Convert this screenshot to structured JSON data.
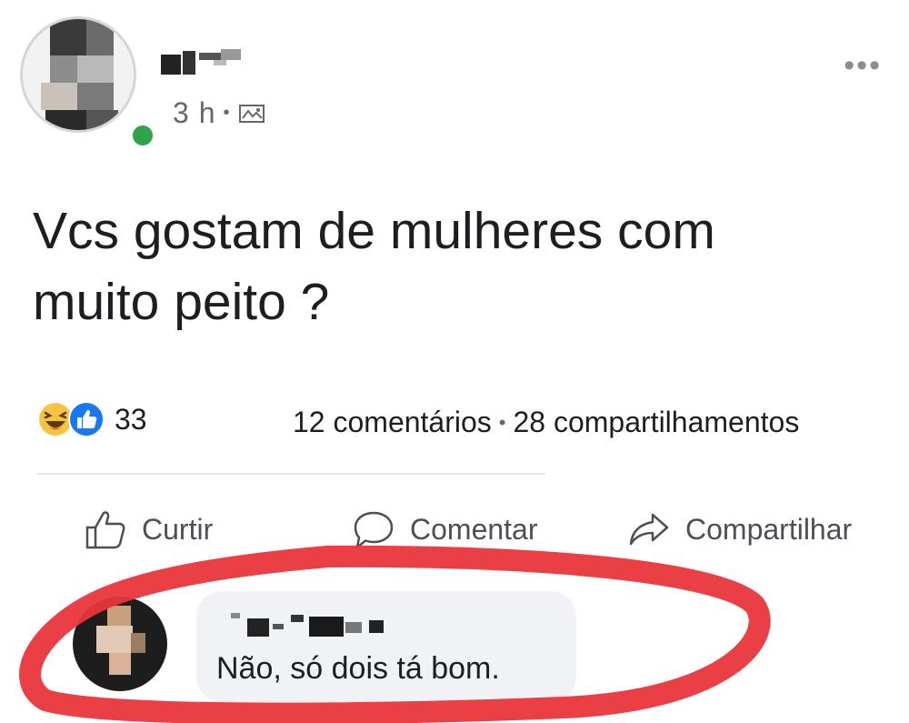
{
  "post": {
    "author_name": "",
    "time": "3 h",
    "separator": "•",
    "privacy_icon": "public-icon",
    "more_label": "•••",
    "text": "Vcs gostam de mulheres com muito peito ?"
  },
  "reactions": {
    "icons": [
      "haha-icon",
      "like-icon"
    ],
    "count": "33"
  },
  "stats": {
    "comments": "12 comentários",
    "separator": "•",
    "shares": "28 compartilhamentos"
  },
  "actions": {
    "like": "Curtir",
    "comment": "Comentar",
    "share": "Compartilhar"
  },
  "comment": {
    "author_name": "",
    "text": "Não, só dois tá bom."
  },
  "colors": {
    "online": "#31a24c",
    "like_blue": "#1877f2",
    "haha_yellow": "#f7c441",
    "highlight_red": "#e8353b",
    "bubble_bg": "#f0f2f5"
  }
}
